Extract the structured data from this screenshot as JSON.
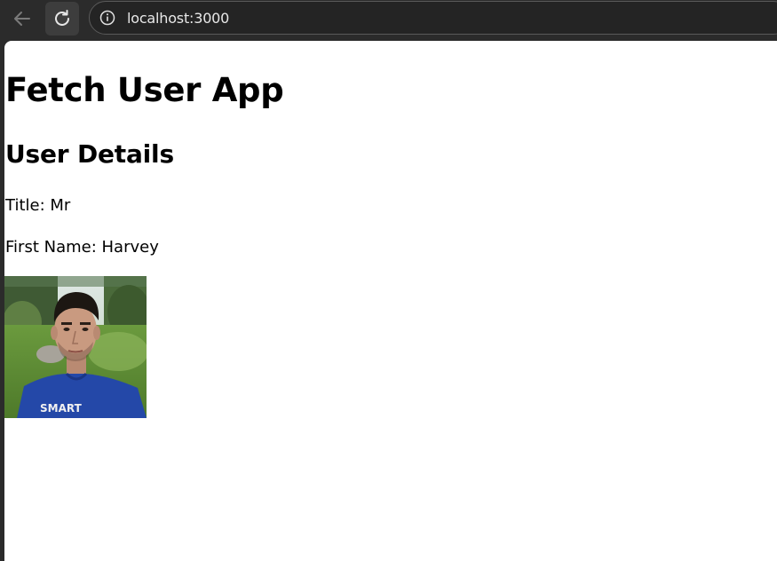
{
  "browser": {
    "url": "localhost:3000",
    "icons": {
      "back": "arrow-left-icon",
      "reload": "reload-icon",
      "site_info": "info-circle-icon"
    }
  },
  "page": {
    "app_title": "Fetch User App",
    "section_title": "User Details",
    "fields": {
      "title_label": "Title:",
      "title_value": "Mr",
      "first_name_label": "First Name:",
      "first_name_value": "Harvey"
    },
    "avatar": {
      "description_icon": "user-photo",
      "shirt_text": "SMART"
    }
  }
}
